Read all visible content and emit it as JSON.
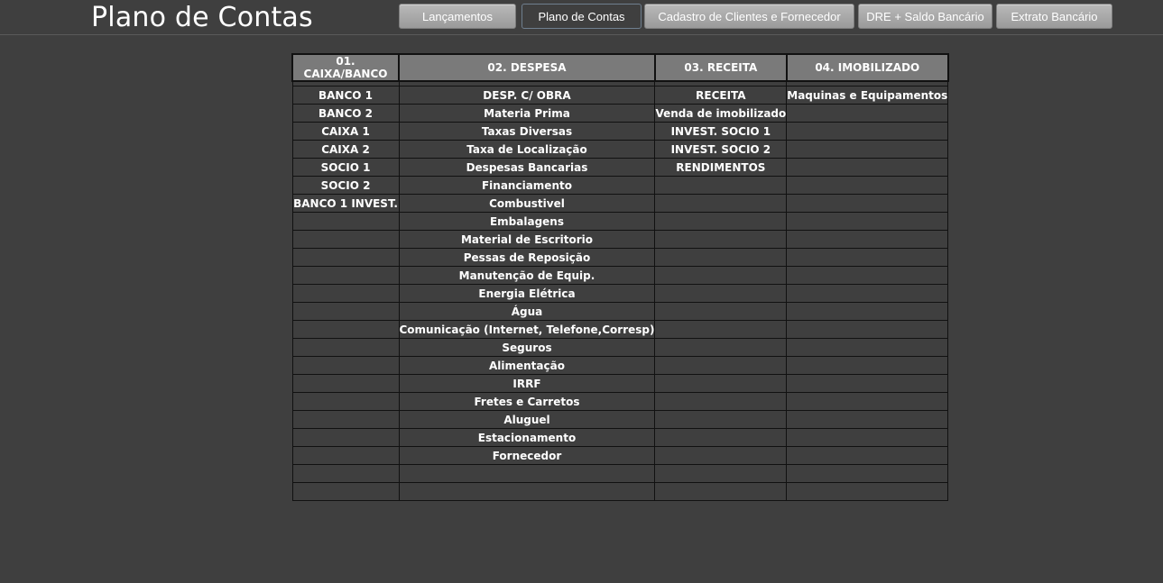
{
  "header": {
    "title": "Plano de Contas"
  },
  "nav": [
    {
      "label": "Lançamentos",
      "name": "nav-lancamentos-button",
      "active": false
    },
    {
      "label": "Plano de Contas",
      "name": "nav-plano-de-contas-button",
      "active": true
    },
    {
      "label": "Cadastro de Clientes  e Fornecedor",
      "name": "nav-cadastro-button",
      "active": false
    },
    {
      "label": "DRE + Saldo Bancário",
      "name": "nav-dre-button",
      "active": false
    },
    {
      "label": "Extrato Bancário",
      "name": "nav-extrato-button",
      "active": false
    }
  ],
  "table": {
    "headers": [
      "01. CAIXA/BANCO",
      "02. DESPESA",
      "03. RECEITA",
      "04. IMOBILIZADO"
    ],
    "columns": [
      [
        "BANCO 1",
        "BANCO 2",
        "CAIXA 1",
        "CAIXA 2",
        "SOCIO 1",
        "SOCIO 2",
        "BANCO 1 INVEST."
      ],
      [
        "DESP. C/ OBRA",
        "Materia Prima",
        "Taxas Diversas",
        "Taxa de Localização",
        "Despesas Bancarias",
        "Financiamento",
        "Combustivel",
        "Embalagens",
        "Material de Escritorio",
        "Pessas de Reposição",
        "Manutenção de Equip.",
        "Energia Elétrica",
        "Água",
        "Comunicação (Internet, Telefone,Corresp)",
        "Seguros",
        "Alimentação",
        "IRRF",
        "Fretes e Carretos",
        "Aluguel",
        "Estacionamento",
        "Fornecedor"
      ],
      [
        "RECEITA",
        "Venda de imobilizado",
        "INVEST. SOCIO 1",
        "INVEST. SOCIO 2",
        "RENDIMENTOS"
      ],
      [
        "Maquinas e Equipamentos"
      ]
    ]
  },
  "colors": {
    "background": "#3f3f3f",
    "header_cell": "#7a7a7a",
    "button": "#ababab",
    "grid": "#111111",
    "text": "#ffffff"
  }
}
